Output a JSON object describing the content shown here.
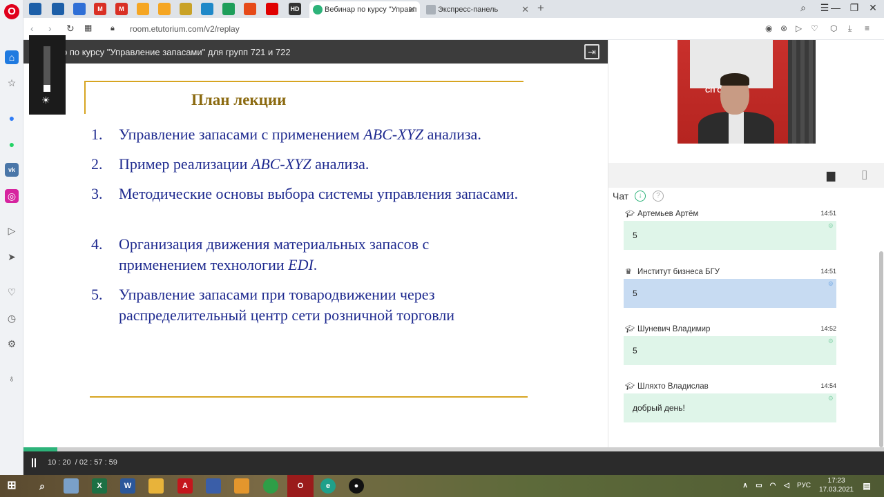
{
  "browser": {
    "pinned_tabs": [
      {
        "icon": "news-site-icon",
        "color": "#1d5fa8",
        "label": ""
      },
      {
        "icon": "news-site-icon",
        "color": "#1d5fa8",
        "label": ""
      },
      {
        "icon": "diamond-icon",
        "color": "#2f6fd6",
        "label": ""
      },
      {
        "icon": "gmail-icon",
        "color": "#d93025",
        "label": "M"
      },
      {
        "icon": "gmail-icon",
        "color": "#d93025",
        "label": "M"
      },
      {
        "icon": "mail-icon",
        "color": "#f5a623",
        "label": ""
      },
      {
        "icon": "mail-icon",
        "color": "#f5a623",
        "label": ""
      },
      {
        "icon": "site-icon",
        "color": "#c9a227",
        "label": ""
      },
      {
        "icon": "site-icon",
        "color": "#1e88c8",
        "label": ""
      },
      {
        "icon": "site-icon",
        "color": "#1e9e5a",
        "label": ""
      },
      {
        "icon": "site-icon",
        "color": "#e64a19",
        "label": ""
      },
      {
        "icon": "youtube-icon",
        "color": "#e00000",
        "label": ""
      },
      {
        "icon": "hd-icon",
        "color": "#333333",
        "label": "HD"
      }
    ],
    "active_tab": "Вебинар по курсу \"Управл",
    "inactive_tab": "Экспресс-панель",
    "url": "room.etutorium.com/v2/replay"
  },
  "player": {
    "title": "р по курсу \"Управление запасами\" для групп 721 и 722",
    "current_time": "10 : 20",
    "total_time": "/ 02 : 57 : 59",
    "progress_fraction": 0.058
  },
  "slide": {
    "title": "План лекции",
    "items": [
      {
        "num": "1.",
        "pre": "Управление запасами с применением ",
        "em": "ABC-XYZ",
        "post": " анализа."
      },
      {
        "num": "2.",
        "pre": "Пример реализации ",
        "em": "ABC-XYZ",
        "post": " анализа."
      },
      {
        "num": "3.",
        "pre": "Методические основы выбора системы управления запасами.",
        "em": "",
        "post": ""
      },
      {
        "num": "4.",
        "pre": "Организация движения материальных запасов с применением технологии ",
        "em": "EDI",
        "post": "."
      },
      {
        "num": "5.",
        "pre": "Управление запасами при товародвижении через распределительный центр сети розничной торговли",
        "em": "",
        "post": ""
      }
    ]
  },
  "video": {
    "banner_text": "СП    ОСТИ:"
  },
  "chat": {
    "label": "Чат",
    "messages": [
      {
        "author": "Артемьев Артём",
        "time": "14:51",
        "text": "5",
        "role": "student"
      },
      {
        "author": "Институт бизнеса БГУ",
        "time": "14:51",
        "text": "5",
        "role": "host"
      },
      {
        "author": "Шуневич Владимир",
        "time": "14:52",
        "text": "5",
        "role": "student"
      },
      {
        "author": "Шляхто Владислав",
        "time": "14:54",
        "text": "добрый день!",
        "role": "student"
      }
    ]
  },
  "taskbar": {
    "lang": "РУС",
    "time": "17:23",
    "date": "17.03.2021"
  }
}
